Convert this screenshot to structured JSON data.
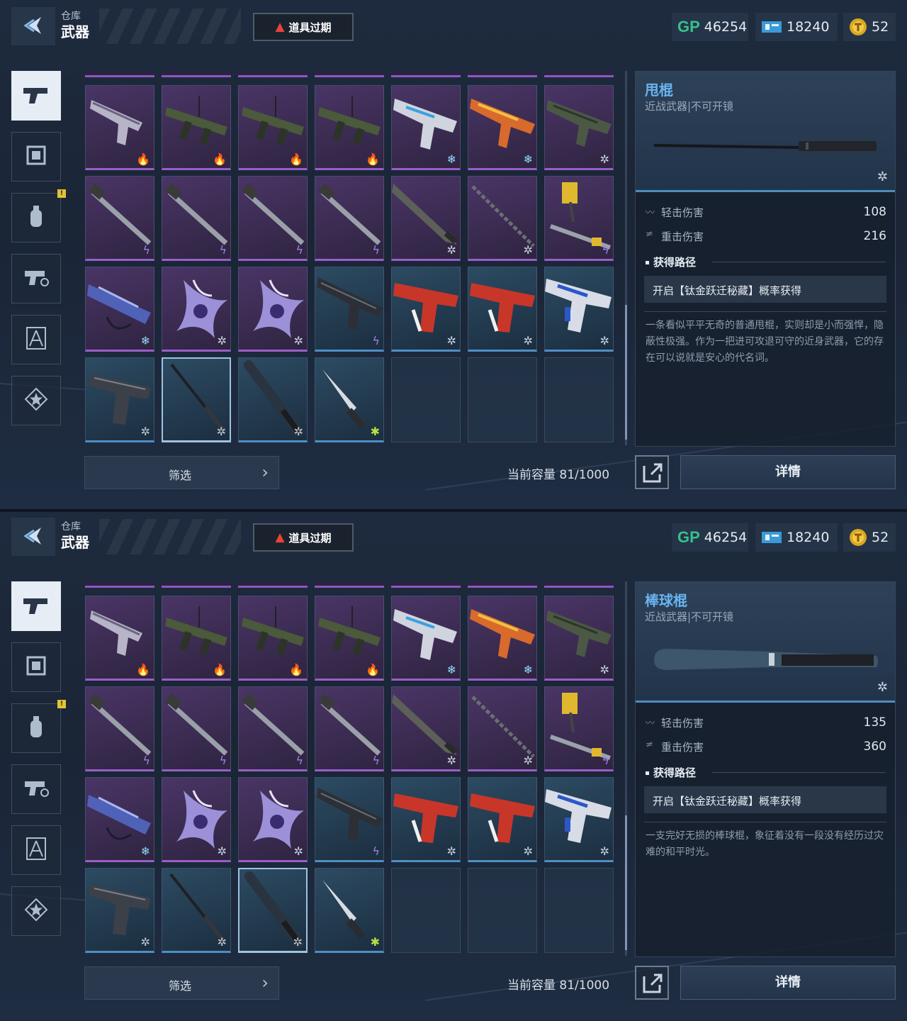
{
  "header": {
    "crumb_parent": "仓库",
    "crumb_title": "武器",
    "warning_label": "道具过期",
    "currencies": [
      {
        "name": "GP",
        "value": "46254",
        "icon": "gp-icon"
      },
      {
        "name": "ticket",
        "value": "18240",
        "icon": "ticket-icon"
      },
      {
        "name": "coin",
        "value": "52",
        "icon": "gold-coin-icon"
      }
    ]
  },
  "sidebar": {
    "items": [
      {
        "name": "pistol-category",
        "icon": "pistol-icon",
        "active": true
      },
      {
        "name": "frame-category",
        "icon": "frame-icon",
        "active": false
      },
      {
        "name": "grenade-category",
        "icon": "grenade-icon",
        "active": false,
        "badge": "!"
      },
      {
        "name": "gear-category",
        "icon": "weapon-parts-icon",
        "active": false
      },
      {
        "name": "character-category",
        "icon": "character-icon",
        "active": false
      },
      {
        "name": "star-badge-category",
        "icon": "star-badge-icon",
        "active": false
      }
    ]
  },
  "grid": {
    "rows": [
      [
        {
          "weapon": "pistol",
          "rarity": "purple",
          "icon": "fire"
        },
        {
          "weapon": "rocket-launcher",
          "rarity": "purple",
          "icon": "fire"
        },
        {
          "weapon": "rocket-launcher",
          "rarity": "purple",
          "icon": "fire"
        },
        {
          "weapon": "rocket-launcher",
          "rarity": "purple",
          "icon": "fire"
        },
        {
          "weapon": "smg-white",
          "rarity": "purple",
          "icon": "snow"
        },
        {
          "weapon": "rifle-orange",
          "rarity": "purple",
          "icon": "snow"
        },
        {
          "weapon": "rifle-green",
          "rarity": "purple",
          "icon": "gear"
        }
      ],
      [
        {
          "weapon": "pipe-wrench",
          "rarity": "purple",
          "icon": "bolt"
        },
        {
          "weapon": "pipe-wrench",
          "rarity": "purple",
          "icon": "bolt"
        },
        {
          "weapon": "pipe-wrench",
          "rarity": "purple",
          "icon": "bolt"
        },
        {
          "weapon": "pipe-wrench",
          "rarity": "purple",
          "icon": "bolt"
        },
        {
          "weapon": "machete",
          "rarity": "purple",
          "icon": "gear"
        },
        {
          "weapon": "chain-whip",
          "rarity": "purple",
          "icon": "gear"
        },
        {
          "weapon": "gold-hammer",
          "rarity": "purple",
          "icon": "bolt"
        }
      ],
      [
        {
          "weapon": "crossbow-blue",
          "rarity": "purple",
          "icon": "snow"
        },
        {
          "weapon": "shuriken",
          "rarity": "purple",
          "icon": "gear"
        },
        {
          "weapon": "shuriken",
          "rarity": "purple",
          "icon": "gear"
        },
        {
          "weapon": "shotgun-black",
          "rarity": "blue",
          "icon": "bolt"
        },
        {
          "weapon": "pistol-red",
          "rarity": "blue",
          "icon": "gear"
        },
        {
          "weapon": "pistol-red",
          "rarity": "blue",
          "icon": "gear"
        },
        {
          "weapon": "smg-bluewhite",
          "rarity": "blue",
          "icon": "gear"
        }
      ],
      [
        {
          "weapon": "pistol-black",
          "rarity": "blue",
          "icon": "gray"
        },
        {
          "weapon": "baton",
          "rarity": "blue",
          "icon": "gray"
        },
        {
          "weapon": "bat",
          "rarity": "blue",
          "icon": "gray"
        },
        {
          "weapon": "knife",
          "rarity": "blue",
          "icon": "green"
        },
        {
          "weapon": "",
          "rarity": "empty",
          "icon": ""
        },
        {
          "weapon": "",
          "rarity": "empty",
          "icon": ""
        },
        {
          "weapon": "",
          "rarity": "empty",
          "icon": ""
        }
      ]
    ]
  },
  "bottom": {
    "filter_label": "筛选",
    "capacity_label": "当前容量 81/1000",
    "details_label": "详情"
  },
  "panels": [
    {
      "selected_index": [
        3,
        1
      ],
      "item": {
        "name": "甩棍",
        "subtitle": "近战武器|不可开镜",
        "image": "baton",
        "light_label": "轻击伤害",
        "light_value": "108",
        "heavy_label": "重击伤害",
        "heavy_value": "216",
        "source_title": "获得路径",
        "source_text": "开启【钛金跃迁秘藏】概率获得",
        "description": "一条看似平平无奇的普通甩棍，实则却是小而强悍，隐蔽性极强。作为一把进可攻退可守的近身武器，它的存在可以说就是安心的代名词。"
      }
    },
    {
      "selected_index": [
        3,
        2
      ],
      "item": {
        "name": "棒球棍",
        "subtitle": "近战武器|不可开镜",
        "image": "bat",
        "light_label": "轻击伤害",
        "light_value": "135",
        "heavy_label": "重击伤害",
        "heavy_value": "360",
        "source_title": "获得路径",
        "source_text": "开启【钛金跃迁秘藏】概率获得",
        "description": "一支完好无损的棒球棍，象征着没有一段没有经历过灾难的和平时光。"
      }
    }
  ],
  "colors": {
    "rarity_purple": "#9a5ec9",
    "rarity_blue": "#4e8fc4",
    "name_blue": "#69b3f0",
    "warn_red": "#e8433a",
    "gp_green": "#36c28a"
  }
}
